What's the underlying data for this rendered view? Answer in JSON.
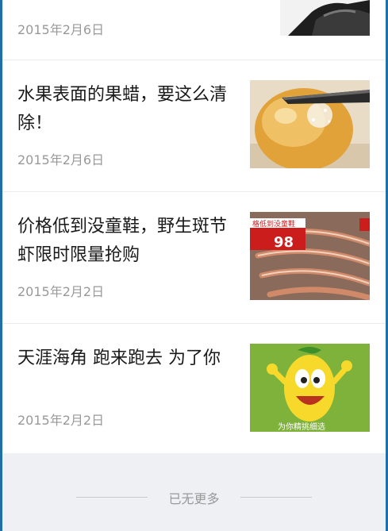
{
  "articles": [
    {
      "title": "",
      "date": "2015年2月6日",
      "thumb": "dark-product-photo"
    },
    {
      "title": "水果表面的果蜡，要这么清除！",
      "date": "2015年2月6日",
      "thumb": "apple-knife-photo"
    },
    {
      "title": "价格低到没童鞋，野生斑节虾限时限量抢购",
      "date": "2015年2月2日",
      "thumb": "shrimp-promo-photo",
      "thumb_text": {
        "banner": "格低到没童鞋",
        "price": "98"
      }
    },
    {
      "title": "天涯海角 跑来跑去 为了你",
      "date": "2015年2月2日",
      "thumb": "lemon-cartoon-image",
      "thumb_text": {
        "caption": "为你精挑细选"
      }
    }
  ],
  "footer": {
    "end_text": "已无更多"
  },
  "colors": {
    "accent_border": "#1f6fa8",
    "footer_bg": "#eef0f3",
    "date": "#999999"
  }
}
